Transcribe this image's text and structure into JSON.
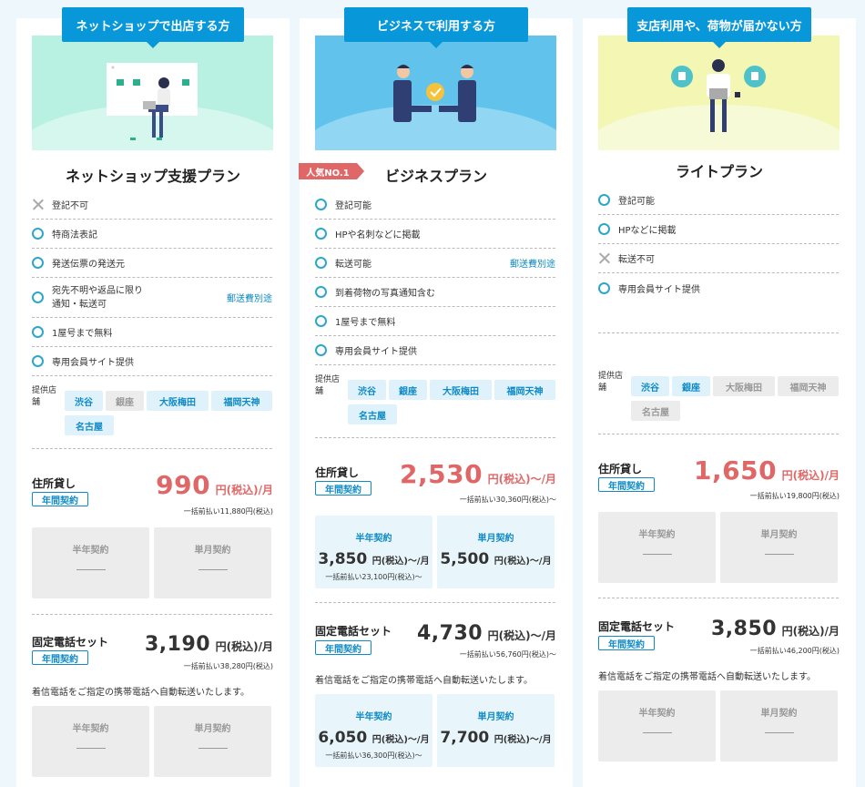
{
  "plans": [
    {
      "tab": "ネットショップで出店する方",
      "name": "ネットショップ支援プラン",
      "features": [
        {
          "mark": "x",
          "text": "登記不可"
        },
        {
          "mark": "o",
          "text": "特商法表記"
        },
        {
          "mark": "o",
          "text": "発送伝票の発送元"
        },
        {
          "mark": "o",
          "text": "宛先不明や返品に限り",
          "text2": "通知・転送可",
          "note": "郵送費別途"
        },
        {
          "mark": "o",
          "text": "1屋号まで無料"
        },
        {
          "mark": "o",
          "text": "専用会員サイト提供"
        }
      ],
      "stores_label": "提供店舗",
      "stores": [
        {
          "name": "渋谷",
          "on": true
        },
        {
          "name": "銀座",
          "on": false
        },
        {
          "name": "大阪梅田",
          "on": true
        },
        {
          "name": "福岡天神",
          "on": true
        },
        {
          "name": "名古屋",
          "on": true
        }
      ],
      "address": {
        "title": "住所貸し",
        "badge": "年間契約",
        "price": "990",
        "unit": "円(税込)/月",
        "lump": "一括前払い11,880円(税込)",
        "half": {
          "title": "半年契約"
        },
        "month": {
          "title": "単月契約"
        }
      },
      "phone": {
        "title": "固定電話セット",
        "badge": "年間契約",
        "price": "3,190",
        "unit": "円(税込)/月",
        "lump": "一括前払い38,280円(税込)",
        "desc": "着信電話をご指定の携帯電話へ自動転送いたします。",
        "half": {
          "title": "半年契約"
        },
        "month": {
          "title": "単月契約"
        }
      }
    },
    {
      "tab": "ビジネスで利用する方",
      "name": "ビジネスプラン",
      "badge": "人気NO.1",
      "features": [
        {
          "mark": "o",
          "text": "登記可能"
        },
        {
          "mark": "o",
          "text": "HPや名刺などに掲載"
        },
        {
          "mark": "o",
          "text": "転送可能",
          "note": "郵送費別途"
        },
        {
          "mark": "o",
          "text": "到着荷物の写真通知含む"
        },
        {
          "mark": "o",
          "text": "1屋号まで無料"
        },
        {
          "mark": "o",
          "text": "専用会員サイト提供"
        }
      ],
      "stores_label": "提供店舗",
      "stores": [
        {
          "name": "渋谷",
          "on": true
        },
        {
          "name": "銀座",
          "on": true
        },
        {
          "name": "大阪梅田",
          "on": true
        },
        {
          "name": "福岡天神",
          "on": true
        },
        {
          "name": "名古屋",
          "on": true
        }
      ],
      "address": {
        "title": "住所貸し",
        "badge": "年間契約",
        "price": "2,530",
        "unit": "円(税込)～/月",
        "lump": "一括前払い30,360円(税込)～",
        "half": {
          "title": "半年契約",
          "price": "3,850",
          "unit": "円(税込)～/月",
          "lump": "一括前払い23,100円(税込)～"
        },
        "month": {
          "title": "単月契約",
          "price": "5,500",
          "unit": "円(税込)～/月"
        }
      },
      "phone": {
        "title": "固定電話セット",
        "badge": "年間契約",
        "price": "4,730",
        "unit": "円(税込)～/月",
        "lump": "一括前払い56,760円(税込)～",
        "desc": "着信電話をご指定の携帯電話へ自動転送いたします。",
        "half": {
          "title": "半年契約",
          "price": "6,050",
          "unit": "円(税込)～/月",
          "lump": "一括前払い36,300円(税込)～"
        },
        "month": {
          "title": "単月契約",
          "price": "7,700",
          "unit": "円(税込)～/月"
        }
      }
    },
    {
      "tab": "支店利用や、荷物が届かない方",
      "name": "ライトプラン",
      "features": [
        {
          "mark": "o",
          "text": "登記可能"
        },
        {
          "mark": "o",
          "text": "HPなどに掲載"
        },
        {
          "mark": "x",
          "text": "転送不可"
        },
        {
          "mark": "o",
          "text": "専用会員サイト提供"
        }
      ],
      "stores_label": "提供店舗",
      "stores": [
        {
          "name": "渋谷",
          "on": true
        },
        {
          "name": "銀座",
          "on": true
        },
        {
          "name": "大阪梅田",
          "on": false
        },
        {
          "name": "福岡天神",
          "on": false
        },
        {
          "name": "名古屋",
          "on": false
        }
      ],
      "address": {
        "title": "住所貸し",
        "badge": "年間契約",
        "price": "1,650",
        "unit": "円(税込)/月",
        "lump": "一括前払い19,800円(税込)",
        "half": {
          "title": "半年契約"
        },
        "month": {
          "title": "単月契約"
        }
      },
      "phone": {
        "title": "固定電話セット",
        "badge": "年間契約",
        "price": "3,850",
        "unit": "円(税込)/月",
        "lump": "一括前払い46,200円(税込)",
        "desc": "着信電話をご指定の携帯電話へ自動転送いたします。",
        "half": {
          "title": "半年契約"
        },
        "month": {
          "title": "単月契約"
        }
      }
    }
  ],
  "colors": {
    "accent": "#0897d8",
    "price_red": "#e06767",
    "mark": "#2da7c8"
  }
}
